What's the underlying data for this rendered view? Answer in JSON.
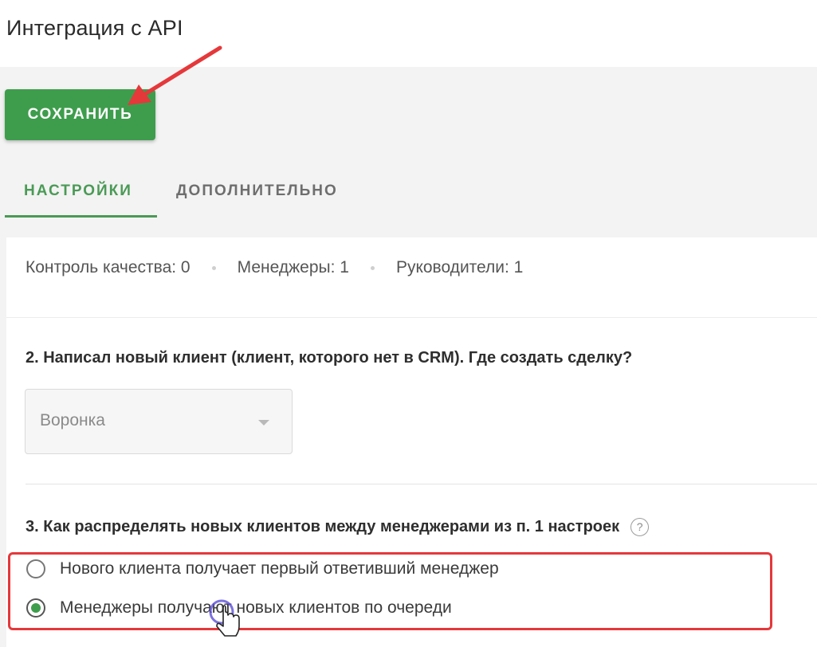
{
  "page": {
    "title": "Интеграция с API"
  },
  "toolbar": {
    "save_label": "СОХРАНИТЬ"
  },
  "tabs": [
    {
      "label": "НАСТРОЙКИ",
      "active": true
    },
    {
      "label": "ДОПОЛНИТЕЛЬНО",
      "active": false
    }
  ],
  "stats": [
    {
      "label": "Контроль качества: 0"
    },
    {
      "label": "Менеджеры: 1"
    },
    {
      "label": "Руководители: 1"
    }
  ],
  "question2": {
    "title": "2. Написал новый клиент (клиент, которого нет в CRM). Где создать сделку?",
    "select_placeholder": "Воронка"
  },
  "question3": {
    "title": "3. Как распределять новых клиентов между менеджерами из п. 1 настроек",
    "help_icon": "?",
    "options": [
      {
        "label": "Нового клиента получает первый ответивший менеджер",
        "selected": false
      },
      {
        "label": "Менеджеры получают новых клиентов по очереди",
        "selected": true
      }
    ]
  },
  "colors": {
    "accent_green": "#3e9d4c",
    "annotation_red": "#e5383b"
  },
  "icons": {
    "arrow": "red-arrow-annotation",
    "cursor": "hand-pointer-icon",
    "help": "question-circle-icon",
    "dropdown": "chevron-down-icon"
  }
}
